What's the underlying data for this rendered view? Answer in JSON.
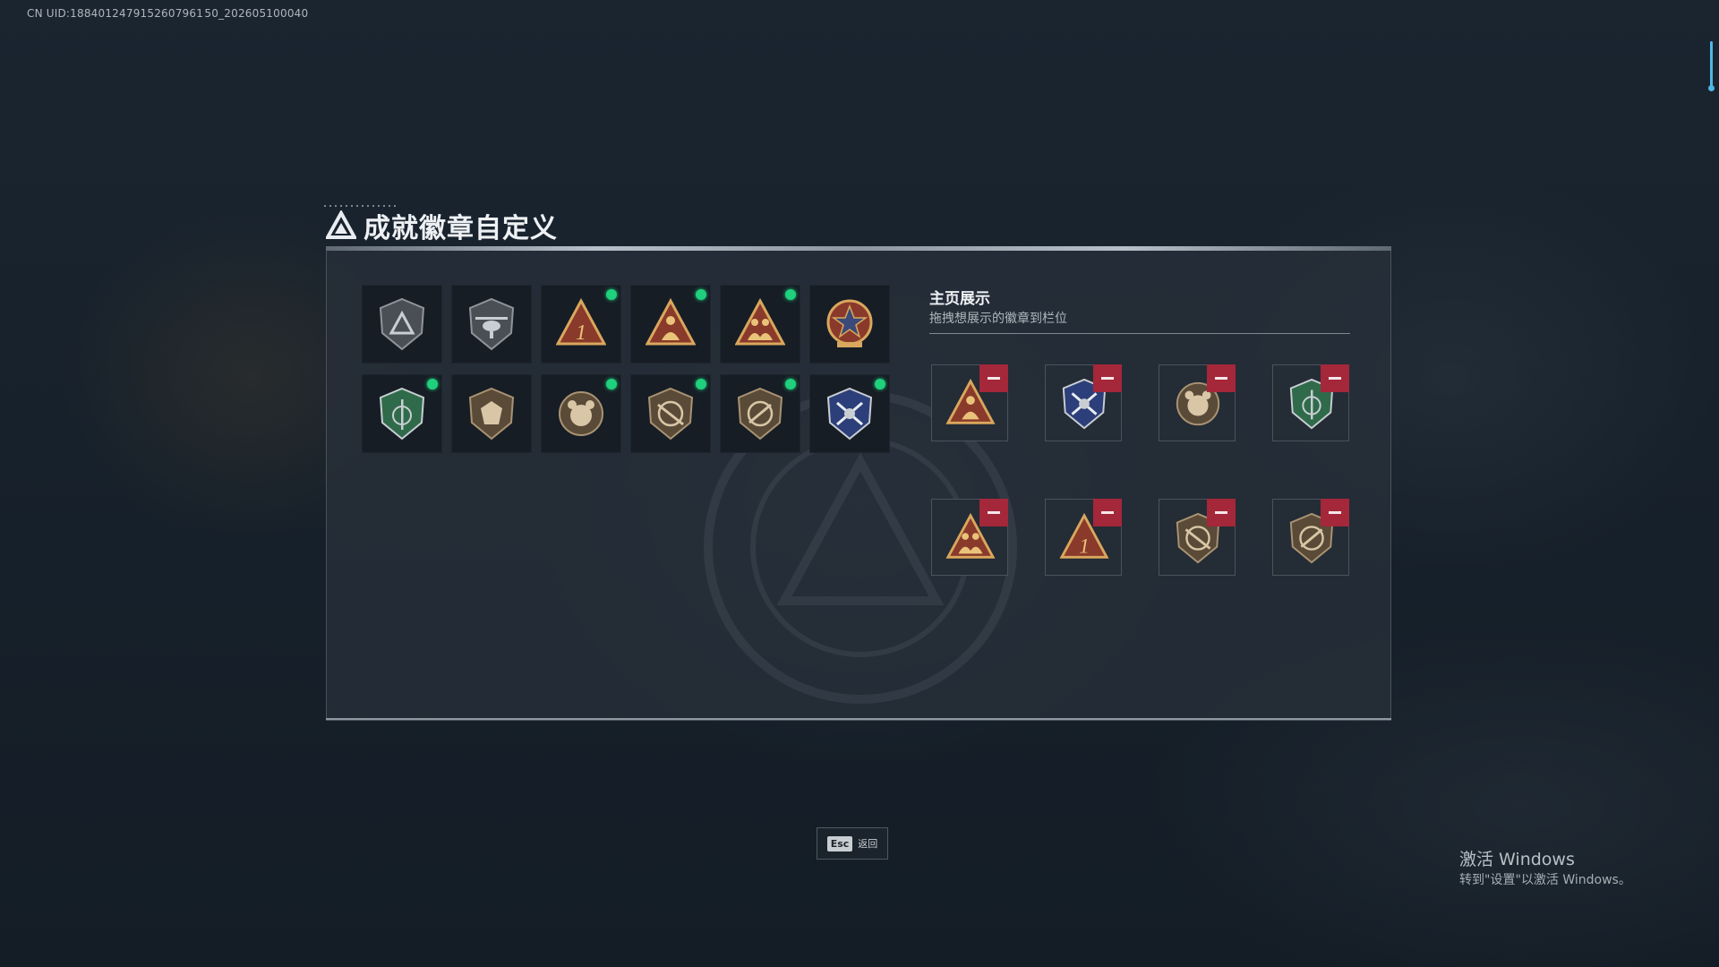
{
  "uid_text": "CN UID:1884012479152607961 50_202605100040",
  "window": {
    "title": "成就徽章自定义",
    "title_icon": "delta-triangle-logo-icon"
  },
  "badges": [
    {
      "name": "delta-triangle-shield-badge",
      "color": "#4a4f55",
      "status_dot": false
    },
    {
      "name": "helicopter-shield-badge",
      "color": "#4a4f55",
      "status_dot": false
    },
    {
      "name": "number-one-triangle-badge",
      "color": "#8a3a2a",
      "status_dot": true
    },
    {
      "name": "soldier-triangle-badge",
      "color": "#8a3a2a",
      "status_dot": true
    },
    {
      "name": "squad-triangle-badge",
      "color": "#8a3a2a",
      "status_dot": true
    },
    {
      "name": "star-wreath-medal-badge",
      "color": "#8a3a2a",
      "status_dot": false
    },
    {
      "name": "green-sword-shield-badge",
      "color": "#2f6b4a",
      "status_dot": true
    },
    {
      "name": "gem-shield-badge",
      "color": "#5a4b38",
      "status_dot": false
    },
    {
      "name": "bear-emblem-badge",
      "color": "#5a4b38",
      "status_dot": true
    },
    {
      "name": "crossed-rifle-shield-badge",
      "color": "#5a4b38",
      "status_dot": true
    },
    {
      "name": "rifle-shield-badge",
      "color": "#5a4b38",
      "status_dot": true
    },
    {
      "name": "blue-crossed-arrows-shield-badge",
      "color": "#2d3f7a",
      "status_dot": true
    }
  ],
  "display": {
    "title": "主页展示",
    "subtitle": "拖拽想展示的徽章到栏位",
    "slots": [
      {
        "badge": "soldier-triangle-badge",
        "remove_icon": "minus-icon"
      },
      {
        "badge": "blue-crossed-arrows-shield-badge",
        "remove_icon": "minus-icon"
      },
      {
        "badge": "bear-emblem-badge",
        "remove_icon": "minus-icon"
      },
      {
        "badge": "green-sword-shield-badge",
        "remove_icon": "minus-icon"
      },
      {
        "badge": "squad-triangle-badge",
        "remove_icon": "minus-icon"
      },
      {
        "badge": "number-one-triangle-badge",
        "remove_icon": "minus-icon"
      },
      {
        "badge": "crossed-rifle-shield-badge",
        "remove_icon": "minus-icon"
      },
      {
        "badge": "rifle-shield-badge",
        "remove_icon": "minus-icon"
      }
    ]
  },
  "footer": {
    "key": "Esc",
    "label": "返回"
  },
  "activation": {
    "title": "激活 Windows",
    "subtitle": "转到\"设置\"以激活 Windows。"
  },
  "colors": {
    "status_dot": "#1fd07c",
    "remove_button": "#a5273a",
    "accent_line": "#b7c0c8"
  }
}
